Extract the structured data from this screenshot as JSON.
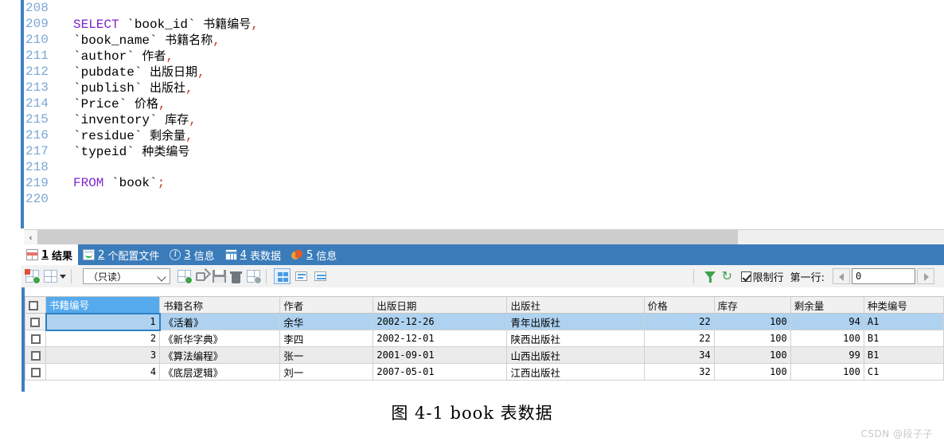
{
  "editor": {
    "line_numbers": [
      "208",
      "209",
      "210",
      "211",
      "212",
      "213",
      "214",
      "215",
      "216",
      "217",
      "218",
      "219",
      "220"
    ],
    "lines": [
      {
        "indent": 0,
        "kw": "",
        "ident": "",
        "alias": "",
        "punc": "",
        "raw": ""
      },
      {
        "indent": 1,
        "kw": "SELECT",
        "ident": "`book_id`",
        "alias": "书籍编号",
        "punc": ","
      },
      {
        "indent": 1,
        "kw": "",
        "ident": "`book_name`",
        "alias": "书籍名称",
        "punc": ","
      },
      {
        "indent": 1,
        "kw": "",
        "ident": "`author`",
        "alias": "作者",
        "punc": ","
      },
      {
        "indent": 1,
        "kw": "",
        "ident": "`pubdate`",
        "alias": "出版日期",
        "punc": ","
      },
      {
        "indent": 1,
        "kw": "",
        "ident": "`publish`",
        "alias": "出版社",
        "punc": ","
      },
      {
        "indent": 1,
        "kw": "",
        "ident": "`Price`",
        "alias": "价格",
        "punc": ","
      },
      {
        "indent": 1,
        "kw": "",
        "ident": "`inventory`",
        "alias": "库存",
        "punc": ","
      },
      {
        "indent": 1,
        "kw": "",
        "ident": "`residue`",
        "alias": "剩余量",
        "punc": ","
      },
      {
        "indent": 1,
        "kw": "",
        "ident": "`typeid`",
        "alias": "种类编号",
        "punc": ""
      },
      {
        "indent": 0,
        "kw": "",
        "ident": "",
        "alias": "",
        "punc": ""
      },
      {
        "indent": 1,
        "kw": "FROM",
        "ident": "`book`",
        "alias": "",
        "punc": ";"
      },
      {
        "indent": 0,
        "kw": "",
        "ident": "",
        "alias": "",
        "punc": ""
      }
    ],
    "line_text": [
      "",
      "SELECT `book_id` 书籍编号,",
      "`book_name` 书籍名称,",
      "`author` 作者,",
      "`pubdate` 出版日期,",
      "`publish` 出版社,",
      "`Price` 价格,",
      "`inventory` 库存,",
      "`residue` 剩余量,",
      "`typeid` 种类编号",
      "",
      "FROM `book`;",
      ""
    ],
    "scrollbar": {
      "left_arrow": "‹"
    }
  },
  "tabs": [
    {
      "num": "1",
      "label": "结果",
      "icon": "results-grid-icon",
      "active": true
    },
    {
      "num": "2",
      "label": "个配置文件",
      "icon": "profile-icon",
      "active": false
    },
    {
      "num": "3",
      "label": "信息",
      "icon": "info-circle-icon",
      "active": false
    },
    {
      "num": "4",
      "label": "表数据",
      "icon": "table-grid-icon",
      "active": false
    },
    {
      "num": "5",
      "label": "信息",
      "icon": "pie-chart-icon",
      "active": false
    }
  ],
  "toolbar": {
    "new_record_icon": "new-record-icon",
    "select_record_icon": "select-record-icon",
    "dropdown_caret_icon": "chevron-down-icon",
    "mode_select_value": "（只读）",
    "add_record_icon": "add-record-icon",
    "share_record_icon": "share-record-icon",
    "save_icon": "save-icon",
    "delete_icon": "trash-icon",
    "remove_record_icon": "remove-record-icon",
    "view_grid_icon": "grid-view-icon",
    "view_form_icon": "form-view-icon",
    "view_note_icon": "note-view-icon",
    "filter_icon": "filter-funnel-icon",
    "refresh_icon": "refresh-icon",
    "limit_rows_label": "限制行",
    "first_row_label": "第一行:",
    "first_row_value": "0",
    "prev_page_icon": "prev-arrow-icon",
    "next_page_icon": "next-arrow-icon"
  },
  "grid": {
    "columns": [
      {
        "key": "book_id",
        "label": "书籍编号",
        "align": "right",
        "highlight": true
      },
      {
        "key": "book_name",
        "label": "书籍名称",
        "align": "left",
        "highlight": false
      },
      {
        "key": "author",
        "label": "作者",
        "align": "left",
        "highlight": false
      },
      {
        "key": "pubdate",
        "label": "出版日期",
        "align": "left",
        "highlight": false
      },
      {
        "key": "publish",
        "label": "出版社",
        "align": "left",
        "highlight": false
      },
      {
        "key": "price",
        "label": "价格",
        "align": "right",
        "highlight": false
      },
      {
        "key": "inventory",
        "label": "库存",
        "align": "right",
        "highlight": false
      },
      {
        "key": "residue",
        "label": "剩余量",
        "align": "right",
        "highlight": false
      },
      {
        "key": "typeid",
        "label": "种类编号",
        "align": "left",
        "highlight": false
      }
    ],
    "rows": [
      {
        "book_id": "1",
        "book_name": "《活着》",
        "author": "余华",
        "pubdate": "2002-12-26",
        "publish": "青年出版社",
        "price": "22",
        "inventory": "100",
        "residue": "94",
        "typeid": "A1",
        "selected": true
      },
      {
        "book_id": "2",
        "book_name": "《新华字典》",
        "author": "李四",
        "pubdate": "2002-12-01",
        "publish": "陕西出版社",
        "price": "22",
        "inventory": "100",
        "residue": "100",
        "typeid": "B1",
        "selected": false
      },
      {
        "book_id": "3",
        "book_name": "《算法编程》",
        "author": "张一",
        "pubdate": "2001-09-01",
        "publish": "山西出版社",
        "price": "34",
        "inventory": "100",
        "residue": "99",
        "typeid": "B1",
        "selected": false
      },
      {
        "book_id": "4",
        "book_name": "《底层逻辑》",
        "author": "刘一",
        "pubdate": "2007-05-01",
        "publish": "江西出版社",
        "price": "32",
        "inventory": "100",
        "residue": "100",
        "typeid": "C1",
        "selected": false
      }
    ]
  },
  "caption": "图 4-1  book 表数据",
  "watermark": "CSDN @段子子",
  "colors": {
    "accent_blue": "#3a7cba",
    "keyword_purple": "#7d26cd",
    "line_number_blue": "#7ba7d7",
    "row_selected": "#aed2f0",
    "header_highlight": "#55aaee",
    "punct_red": "#c0392b"
  }
}
